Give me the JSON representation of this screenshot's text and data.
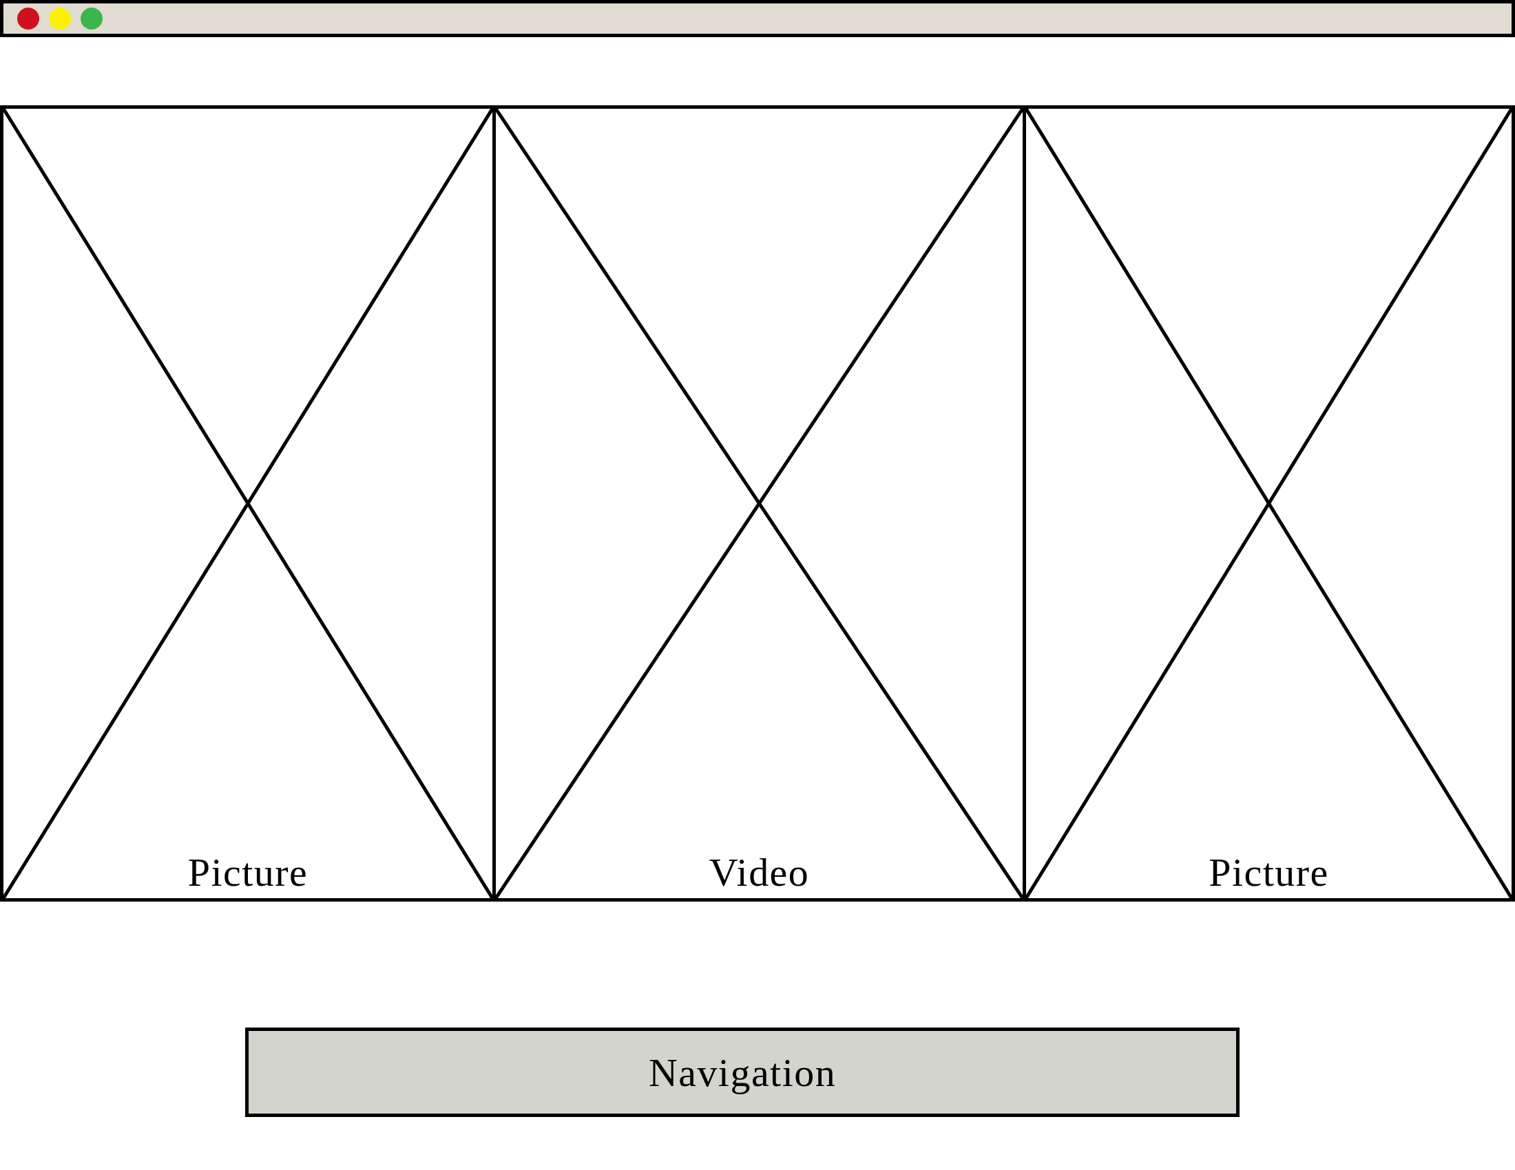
{
  "window": {
    "controls": [
      {
        "color": "#d0101e"
      },
      {
        "color": "#ffef00"
      },
      {
        "color": "#3cb64a"
      }
    ]
  },
  "panels": [
    {
      "label": "Picture"
    },
    {
      "label": "Video"
    },
    {
      "label": "Picture"
    }
  ],
  "navigation": {
    "label": "Navigation"
  }
}
